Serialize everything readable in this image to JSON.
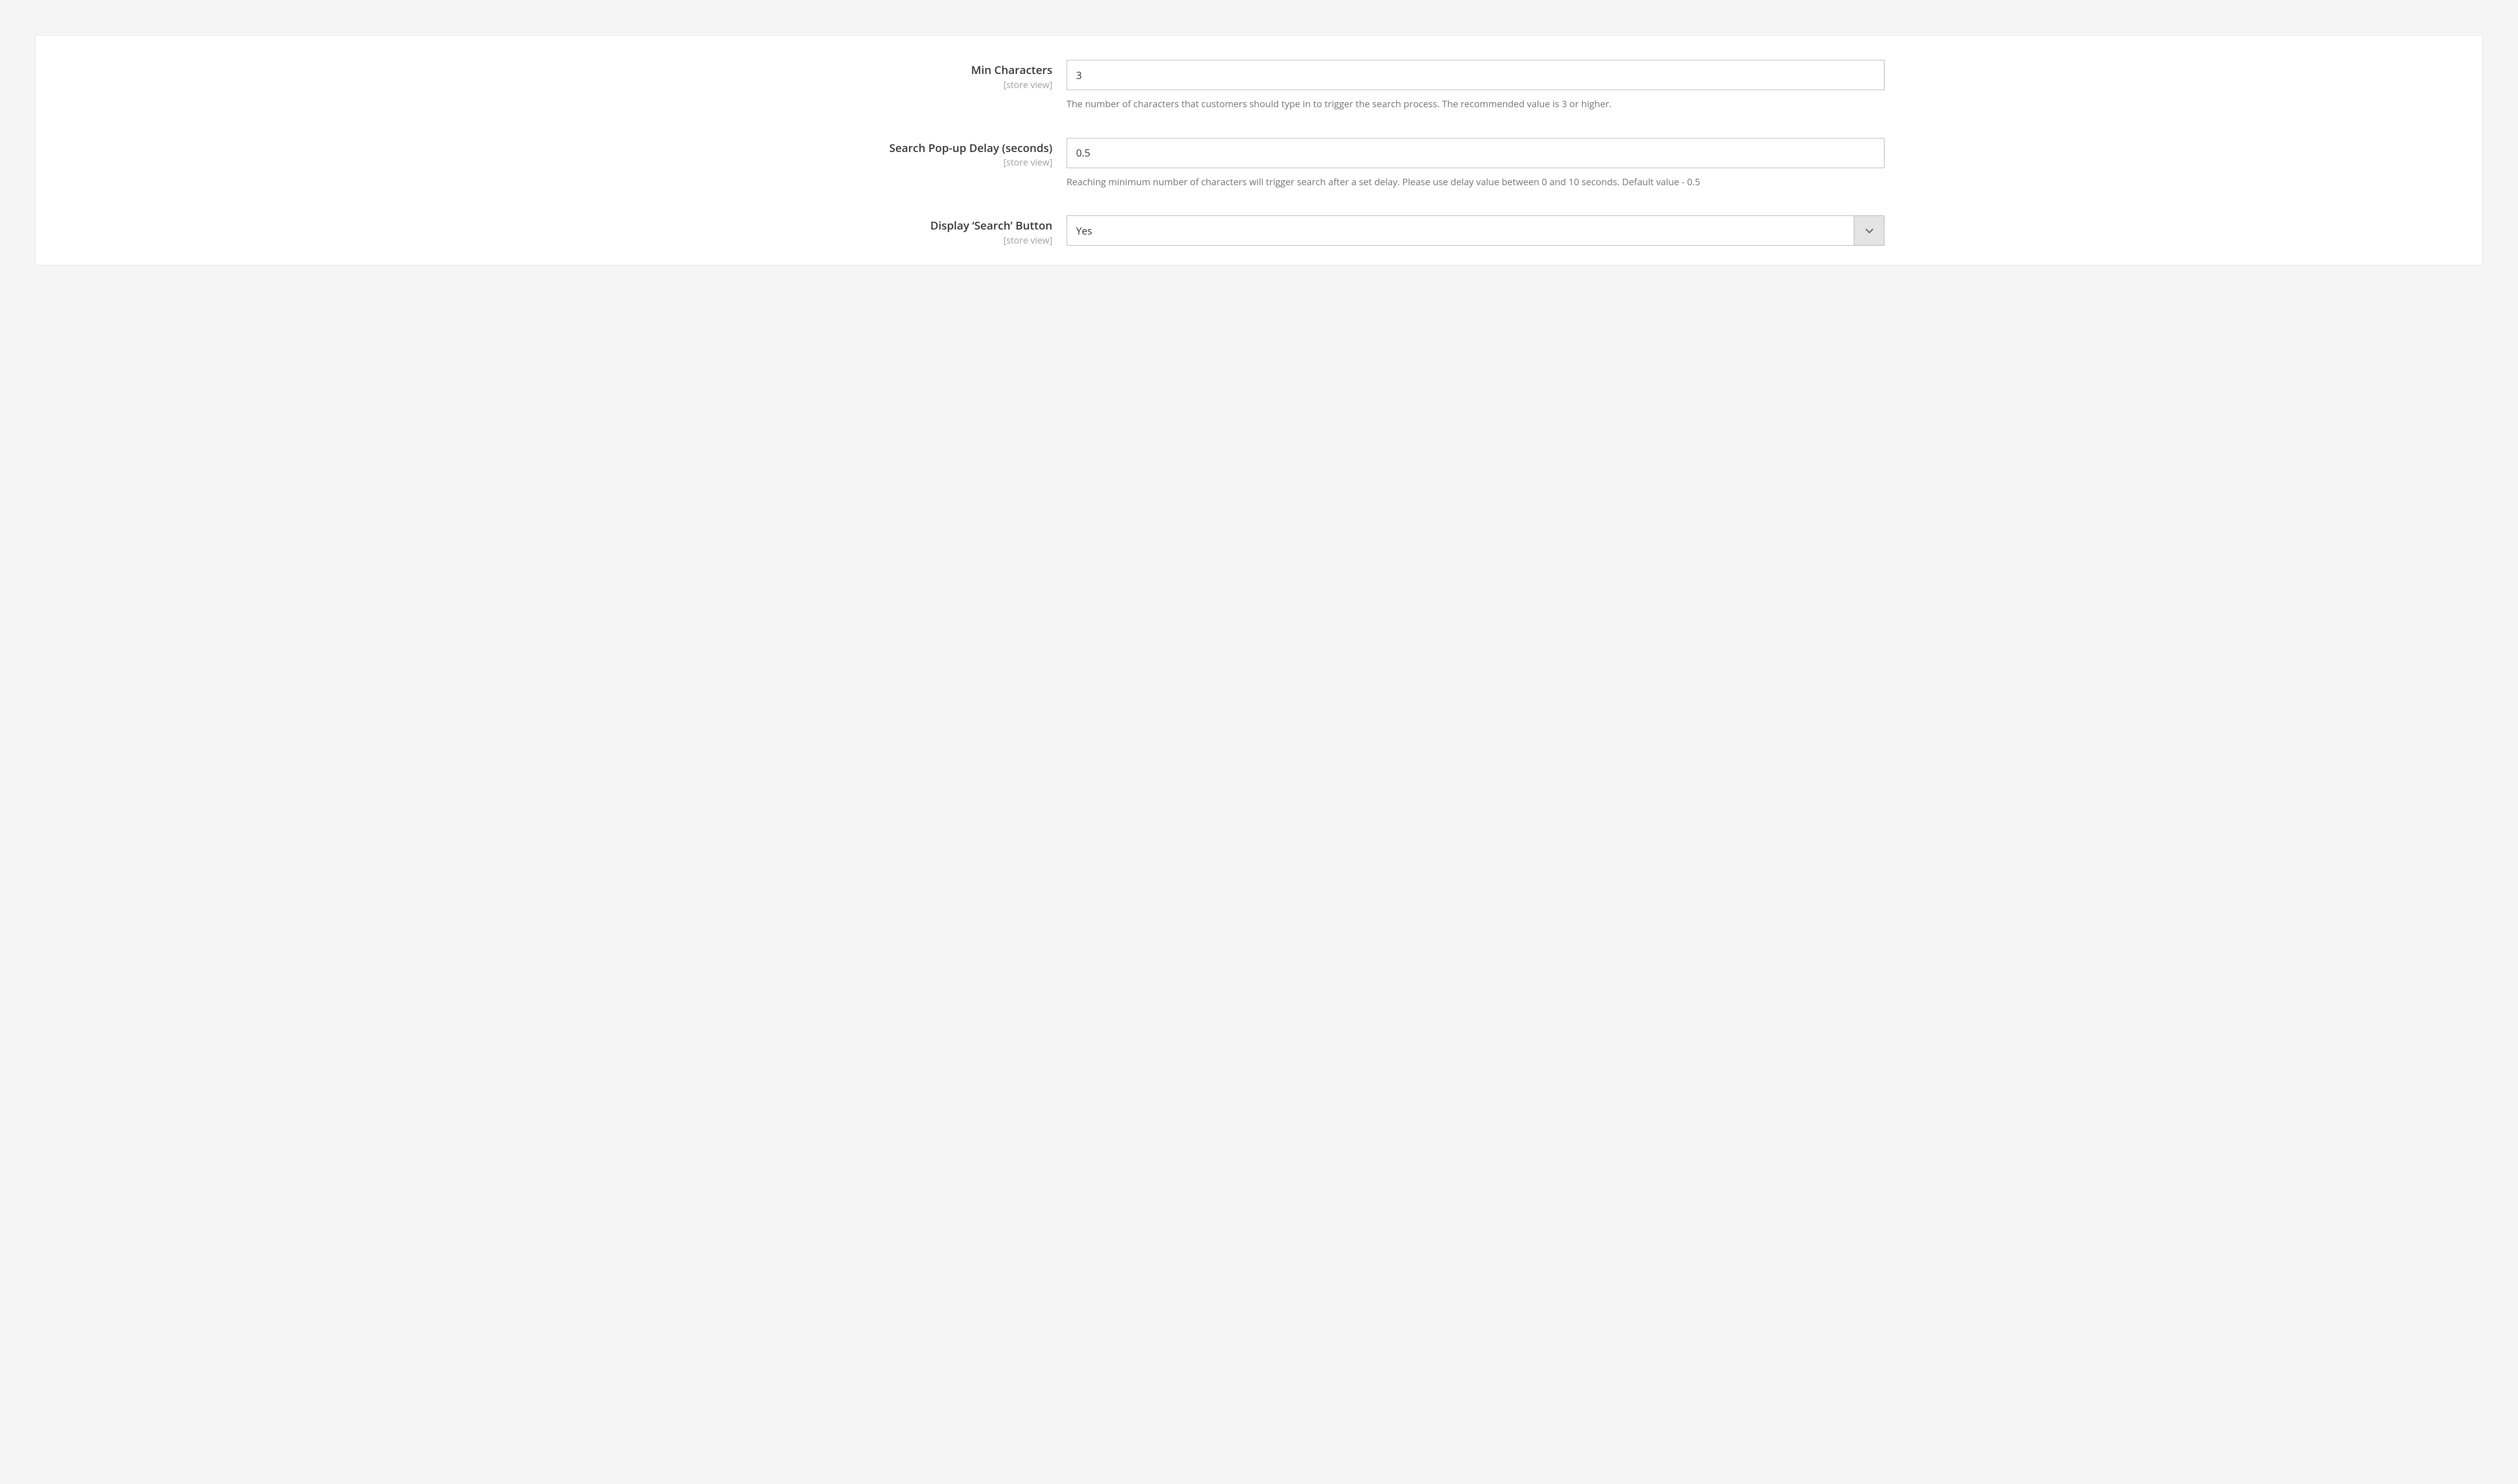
{
  "scope_label": "[store view]",
  "fields": {
    "min_chars": {
      "label": "Min Characters",
      "value": "3",
      "note": "The number of characters that customers should type in to trigger the search process. The recommended value is 3 or higher."
    },
    "popup_delay": {
      "label": "Search Pop-up Delay (seconds)",
      "value": "0.5",
      "note": "Reaching minimum number of characters will trigger search after a set delay. Please use delay value between 0 and 10 seconds. Default value - 0.5"
    },
    "display_search_button": {
      "label": "Display ‘Search’ Button",
      "value": "Yes"
    }
  }
}
